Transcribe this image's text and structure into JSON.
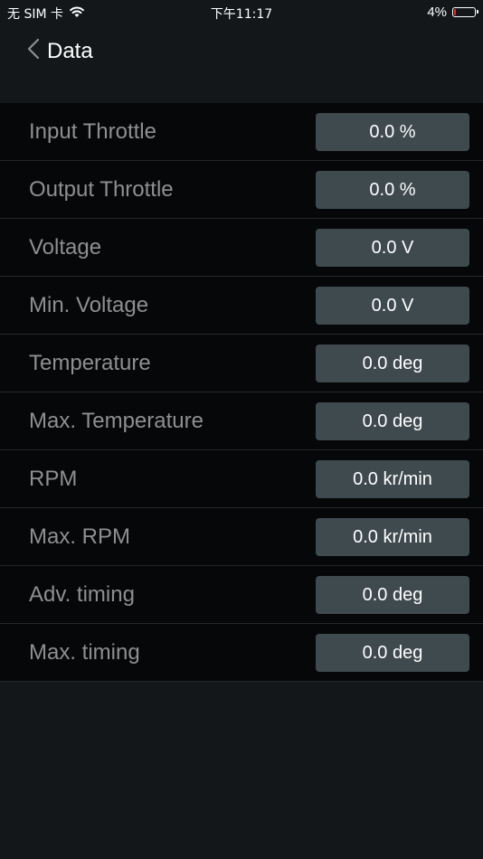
{
  "status_bar": {
    "carrier": "无 SIM 卡",
    "time": "下午11:17",
    "battery_percent": "4%",
    "battery_level": 0.04,
    "wifi_icon": "wifi-icon",
    "battery_color": "#e5281e"
  },
  "header": {
    "back_icon": "chevron-left-icon",
    "title": "Data"
  },
  "rows": [
    {
      "label": "Input Throttle",
      "value": "0.0 %"
    },
    {
      "label": "Output Throttle",
      "value": "0.0 %"
    },
    {
      "label": "Voltage",
      "value": "0.0 V"
    },
    {
      "label": "Min. Voltage",
      "value": "0.0 V"
    },
    {
      "label": "Temperature",
      "value": "0.0 deg"
    },
    {
      "label": "Max. Temperature",
      "value": "0.0 deg"
    },
    {
      "label": "RPM",
      "value": "0.0 kr/min"
    },
    {
      "label": "Max. RPM",
      "value": "0.0 kr/min"
    },
    {
      "label": "Adv. timing",
      "value": "0.0 deg"
    },
    {
      "label": "Max. timing",
      "value": "0.0 deg"
    }
  ],
  "colors": {
    "background": "#13171a",
    "list_background": "#060708",
    "value_box": "#3f4a4f",
    "label_text": "#8d8f91"
  }
}
